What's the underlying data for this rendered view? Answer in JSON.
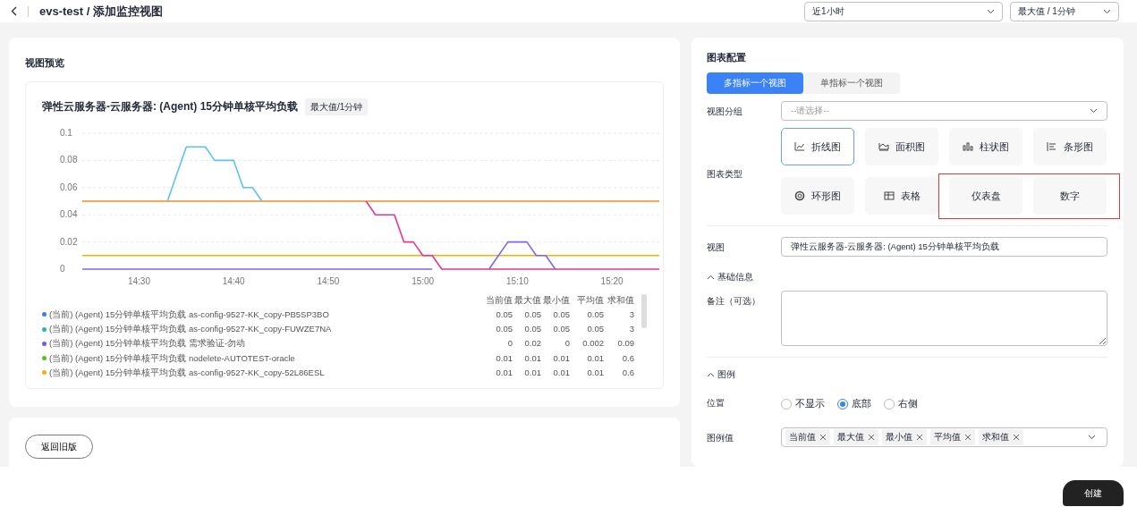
{
  "header": {
    "title": "evs-test / 添加监控视图",
    "time_range": "近1小时",
    "aggregation": "最大值 / 1分钟"
  },
  "preview": {
    "title": "视图预览",
    "chart": {
      "title": "弹性云服务器-云服务器: (Agent) 15分钟单核平均负载",
      "badge": "最大值/1分钟",
      "chart_data": {
        "type": "line",
        "categories": [
          null,
          null,
          null,
          null,
          null,
          null,
          "14:30",
          null,
          null,
          null,
          null,
          null,
          null,
          null,
          null,
          null,
          "14:40",
          null,
          null,
          null,
          null,
          null,
          null,
          null,
          null,
          null,
          "14:50",
          null,
          null,
          null,
          null,
          null,
          null,
          null,
          null,
          null,
          "15:00",
          null,
          null,
          null,
          null,
          null,
          null,
          null,
          null,
          null,
          "15:10",
          null,
          null,
          null,
          null,
          null,
          null,
          null,
          null,
          null,
          "15:20",
          null,
          null,
          null,
          null,
          null
        ],
        "ylim": [
          0,
          0.1
        ],
        "grid": true,
        "yticks": [
          0,
          0.02,
          0.04,
          0.06,
          0.08,
          0.1
        ],
        "series": [
          {
            "color": "#f08c1e",
            "values": [
              0.05,
              0.05,
              0.05,
              0.05,
              0.05,
              0.05,
              0.05,
              0.05,
              0.05,
              0.05,
              0.05,
              0.05,
              0.05,
              0.05,
              0.05,
              0.05,
              0.05,
              0.05,
              0.05,
              0.05,
              0.05,
              0.05,
              0.05,
              0.05,
              0.05,
              0.05,
              0.05,
              0.05,
              0.05,
              0.05,
              0.05,
              0.05,
              0.05,
              0.05,
              0.05,
              0.05,
              0.05,
              0.05,
              0.05,
              0.05,
              0.05,
              0.05,
              0.05,
              0.05,
              0.05,
              0.05,
              0.05,
              0.05,
              0.05,
              0.05,
              0.05,
              0.05,
              0.05,
              0.05,
              0.05,
              0.05,
              0.05,
              0.05,
              0.05,
              0.05,
              0.05,
              0.05
            ]
          },
          {
            "color": "#f0b400",
            "values": [
              0.01,
              0.01,
              0.01,
              0.01,
              0.01,
              0.01,
              0.01,
              0.01,
              0.01,
              0.01,
              0.01,
              0.01,
              0.01,
              0.01,
              0.01,
              0.01,
              0.01,
              0.01,
              0.01,
              0.01,
              0.01,
              0.01,
              0.01,
              0.01,
              0.01,
              0.01,
              0.01,
              0.01,
              0.01,
              0.01,
              0.01,
              0.01,
              0.01,
              0.01,
              0.01,
              0.01,
              0.01,
              0.01,
              0.01,
              0.01,
              0.01,
              0.01,
              0.01,
              0.01,
              0.01,
              0.01,
              0.01,
              0.01,
              0.01,
              0.01,
              0.01,
              0.01,
              0.01,
              0.01,
              0.01,
              0.01,
              0.01,
              0.01,
              0.01,
              0.01,
              0.01,
              0.01
            ]
          },
          {
            "color": "#5bc3f2",
            "values": [
              null,
              null,
              null,
              null,
              null,
              null,
              null,
              null,
              null,
              0.05,
              0.07,
              0.09,
              0.09,
              0.09,
              0.08,
              0.08,
              0.08,
              0.06,
              0.06,
              0.05,
              null,
              null,
              null,
              null,
              null,
              null,
              null,
              null,
              null,
              null,
              null,
              null,
              null,
              null,
              null,
              null,
              null,
              null,
              null,
              null,
              null,
              null,
              null,
              null,
              null,
              null,
              null,
              null,
              null,
              null,
              null,
              null,
              null,
              null,
              null,
              null,
              null,
              null,
              null,
              null,
              null,
              null
            ]
          },
          {
            "color": "#7b68ee",
            "values": [
              0,
              0,
              0,
              0,
              0,
              0,
              0,
              0,
              0,
              0,
              0,
              0,
              0,
              0,
              0,
              0,
              0,
              0,
              0,
              0,
              0,
              0,
              0,
              0,
              0,
              0,
              0,
              0,
              0,
              0,
              0,
              0,
              0,
              0,
              0,
              0,
              0,
              0,
              null,
              null,
              null,
              null,
              null,
              0,
              0.01,
              0.02,
              0.02,
              0.02,
              0.01,
              0.01,
              0,
              null,
              null,
              null,
              null,
              null,
              null,
              null,
              null,
              null,
              null,
              null
            ]
          },
          {
            "color": "#e8368f",
            "values": [
              null,
              null,
              null,
              null,
              null,
              null,
              null,
              null,
              null,
              null,
              null,
              null,
              null,
              null,
              null,
              null,
              null,
              null,
              null,
              null,
              null,
              null,
              null,
              null,
              null,
              null,
              null,
              null,
              null,
              null,
              0.05,
              0.04,
              0.04,
              0.04,
              0.02,
              0.02,
              0.01,
              0.01,
              0,
              0,
              0,
              0,
              0,
              0,
              0,
              0,
              0,
              0,
              0,
              0,
              0,
              0,
              0,
              0,
              0,
              0,
              0,
              0,
              0,
              0,
              0,
              0
            ]
          }
        ]
      }
    },
    "legend": {
      "columns": [
        "当前值",
        "最大值",
        "最小值",
        "平均值",
        "求和值"
      ],
      "rows": [
        {
          "color": "#3b7cf6",
          "name": "(当前) (Agent) 15分钟单核平均负载 as-config-9527-KK_copy-PB5SP3BO",
          "values": [
            "0.05",
            "0.05",
            "0.05",
            "0.05",
            "3"
          ]
        },
        {
          "color": "#2bb5a8",
          "name": "(当前) (Agent) 15分钟单核平均负载 as-config-9527-KK_copy-FUWZE7NA",
          "values": [
            "0.05",
            "0.05",
            "0.05",
            "0.05",
            "3"
          ]
        },
        {
          "color": "#6b5cf0",
          "name": "(当前) (Agent) 15分钟单核平均负载 需求验证-勿动",
          "values": [
            "0",
            "0.02",
            "0",
            "0.002",
            "0.09"
          ]
        },
        {
          "color": "#52c41a",
          "name": "(当前) (Agent) 15分钟单核平均负载 nodelete-AUTOTEST-oracle",
          "values": [
            "0.01",
            "0.01",
            "0.01",
            "0.01",
            "0.6"
          ]
        },
        {
          "color": "#faad14",
          "name": "(当前) (Agent) 15分钟单核平均负载 as-config-9527-KK_copy-52L86ESL",
          "values": [
            "0.01",
            "0.01",
            "0.01",
            "0.01",
            "0.6"
          ]
        }
      ]
    }
  },
  "back_button": "返回旧版",
  "config": {
    "title": "图表配置",
    "modes": [
      {
        "label": "多指标一个视图",
        "selected": true
      },
      {
        "label": "单指标一个视图",
        "selected": false
      }
    ],
    "group": {
      "label": "视图分组",
      "placeholder": "--请选择--"
    },
    "chart_types": {
      "label": "图表类型",
      "items": [
        {
          "label": "折线图",
          "kind": "line",
          "selected": true,
          "highlighted": false
        },
        {
          "label": "面积图",
          "kind": "area",
          "selected": false,
          "highlighted": false
        },
        {
          "label": "柱状图",
          "kind": "column",
          "selected": false,
          "highlighted": false
        },
        {
          "label": "条形图",
          "kind": "bar",
          "selected": false,
          "highlighted": false
        },
        {
          "label": "环形图",
          "kind": "donut",
          "selected": false,
          "highlighted": false
        },
        {
          "label": "表格",
          "kind": "table",
          "selected": false,
          "highlighted": false
        },
        {
          "label": "仪表盘",
          "kind": "gauge",
          "selected": false,
          "highlighted": true
        },
        {
          "label": "数字",
          "kind": "number",
          "selected": false,
          "highlighted": true
        }
      ]
    },
    "view": {
      "label": "视图",
      "value": "弹性云服务器-云服务器: (Agent) 15分钟单核平均负载"
    },
    "basic_section": {
      "title": "基础信息",
      "expanded": true
    },
    "note": {
      "label": "备注（可选）"
    },
    "legend_section": {
      "title": "图例",
      "expanded": true
    },
    "position": {
      "label": "位置",
      "options": [
        {
          "label": "不显示",
          "selected": false
        },
        {
          "label": "底部",
          "selected": true
        },
        {
          "label": "右侧",
          "selected": false
        }
      ]
    },
    "legend_values": {
      "label": "图例值",
      "tags": [
        "当前值",
        "最大值",
        "最小值",
        "平均值",
        "求和值"
      ]
    }
  },
  "create_button": "创建"
}
